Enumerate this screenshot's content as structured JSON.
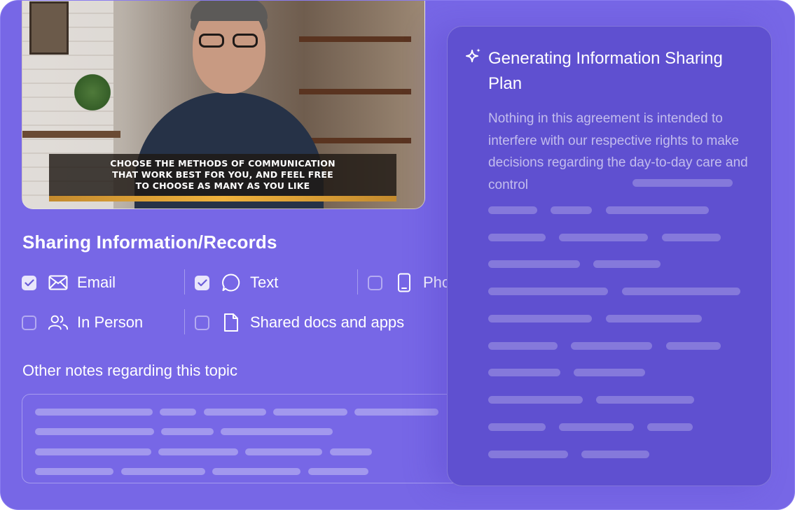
{
  "video": {
    "caption": "CHOOSE THE METHODS OF COMMUNICATION\nTHAT WORK BEST FOR YOU, AND FEEL FREE\nTO CHOOSE AS MANY AS YOU LIKE"
  },
  "section": {
    "title": "Sharing Information/Records",
    "options": [
      {
        "label": "Email",
        "checked": true,
        "icon": "envelope-icon"
      },
      {
        "label": "Text",
        "checked": true,
        "icon": "chat-bubble-icon"
      },
      {
        "label": "Pho",
        "checked": false,
        "icon": "phone-icon"
      },
      {
        "label": "In Person",
        "checked": false,
        "icon": "people-icon"
      },
      {
        "label": "Shared docs and apps",
        "checked": false,
        "icon": "document-icon"
      }
    ],
    "notes_label": "Other notes regarding this topic"
  },
  "panel": {
    "title": "Generating Information Sharing Plan",
    "body": "Nothing in this agreement is intended to interfere with our respective rights to make decisions regarding the day-to-day care and control"
  },
  "colors": {
    "card_bg": "#7767e6",
    "panel_bg": "#5f50d0",
    "check_fill": "#e9e6fb"
  }
}
